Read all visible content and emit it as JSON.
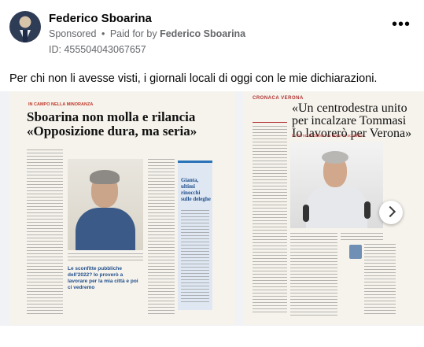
{
  "post": {
    "author_name": "Federico Sboarina",
    "sponsored_label": "Sponsored",
    "separator": "•",
    "paid_prefix": "Paid for by",
    "payer_name": "Federico Sboarina",
    "ad_id": "ID: 455504043067657",
    "more_label": "•••",
    "text": "Per chi non li avesse visti, i giornali locali di oggi con le mie dichiarazioni."
  },
  "carousel": {
    "slides": [
      {
        "kicker": "IN CAMPO NELLA MINORANZA",
        "headline_line1": "Sboarina non molla e rilancia",
        "headline_line2": "«Opposizione dura, ma seria»",
        "quote": "Le sconfitte pubbliche dell'2022? Io proverò a lavorare per la mia città e poi ci vedremo",
        "side_title": "Gianta, ultimi rinocchi sulle deleghe"
      },
      {
        "section": "CRONACA VERONA",
        "headline_line1": "«Un centrodestra unito",
        "headline_line2": "per incalzare Tommasi",
        "headline_line3": "Io lavorerò per Verona»",
        "subline": "Il ritorno di Sboarina dopo la sconfitta"
      }
    ],
    "next_icon": "chevron-right-icon"
  },
  "colors": {
    "name": "#050505",
    "secondary": "#65676b",
    "accent_red": "#c0392b",
    "accent_blue": "#1f4e8c"
  }
}
